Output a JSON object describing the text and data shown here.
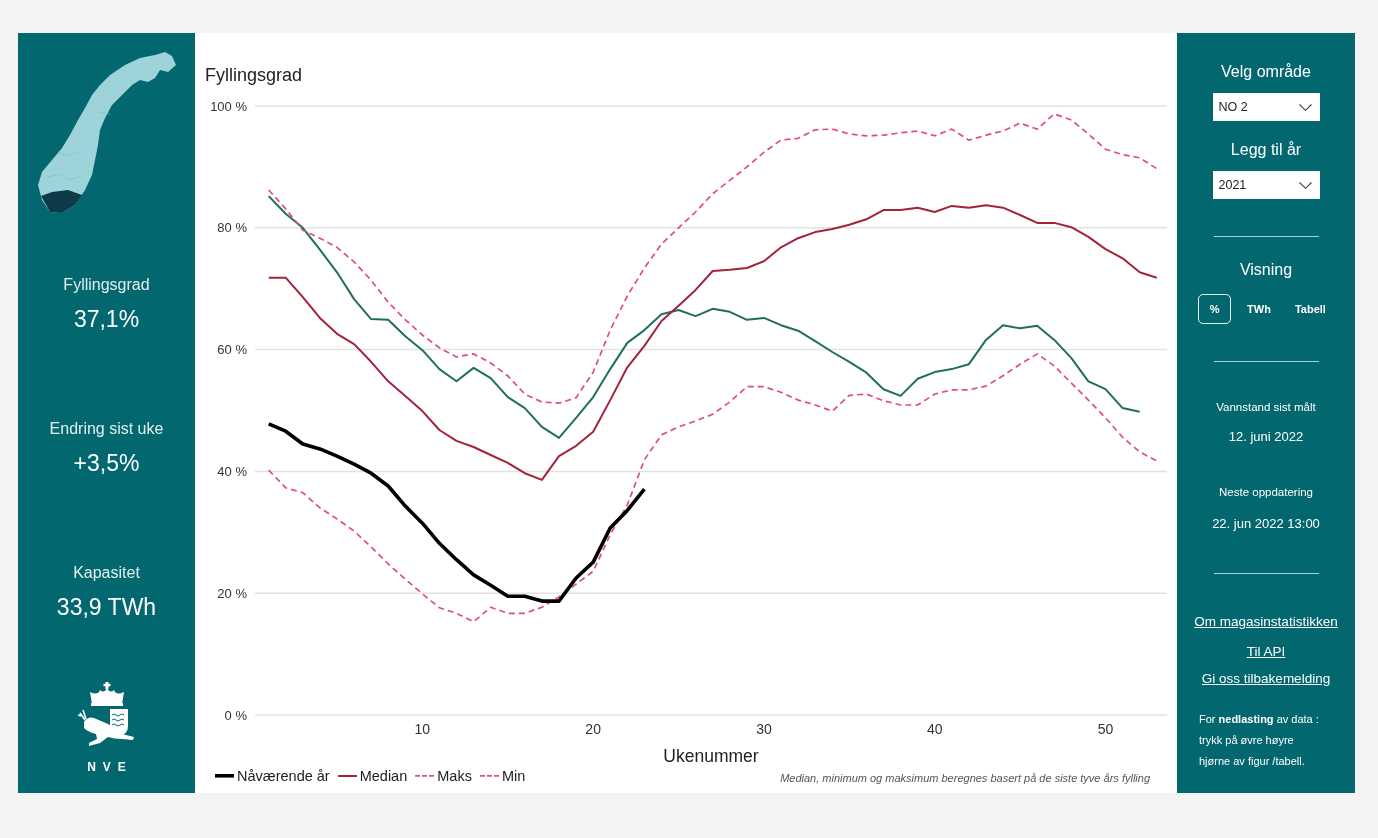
{
  "left_panel": {
    "stats": [
      {
        "label": "Fyllingsgrad",
        "value": "37,1%"
      },
      {
        "label": "Endring sist uke",
        "value": "+3,5%"
      },
      {
        "label": "Kapasitet",
        "value": "33,9 TWh"
      }
    ],
    "logo_text": "NVE"
  },
  "chart": {
    "chart_data": {
      "type": "line",
      "title": "Fyllingsgrad",
      "xlabel": "Ukenummer",
      "x": [
        1,
        2,
        3,
        4,
        5,
        6,
        7,
        8,
        9,
        10,
        11,
        12,
        13,
        14,
        15,
        16,
        17,
        18,
        19,
        20,
        21,
        22,
        23,
        24,
        25,
        26,
        27,
        28,
        29,
        30,
        31,
        32,
        33,
        34,
        35,
        36,
        37,
        38,
        39,
        40,
        41,
        42,
        43,
        44,
        45,
        46,
        47,
        48,
        49,
        50,
        51,
        52,
        53
      ],
      "xlim": [
        0.2,
        53.6
      ],
      "ylim": [
        0,
        100
      ],
      "xticks": [
        10,
        20,
        30,
        40,
        50
      ],
      "yticks": [
        {
          "value": 0,
          "label": "0 %"
        },
        {
          "value": 20,
          "label": "20 %"
        },
        {
          "value": 40,
          "label": "40 %"
        },
        {
          "value": 60,
          "label": "60 %"
        },
        {
          "value": 80,
          "label": "80 %"
        },
        {
          "value": 100,
          "label": "100 %"
        }
      ],
      "grid": true,
      "legend": true,
      "series": [
        {
          "name": "Nåværende år",
          "color": "#000000",
          "line_style": "solid",
          "values": [
            47.8,
            46.6,
            44.5,
            43.7,
            42.5,
            41.2,
            39.7,
            37.6,
            34.3,
            31.5,
            28.2,
            25.5,
            23.0,
            21.3,
            19.5,
            19.5,
            18.7,
            18.7,
            22.5,
            25.1,
            30.7,
            33.6,
            37.1,
            null,
            null,
            null,
            null,
            null,
            null,
            null,
            null,
            null,
            null,
            null,
            null,
            null,
            null,
            null,
            null,
            null,
            null,
            null,
            null,
            null,
            null,
            null,
            null,
            null,
            null,
            null,
            null,
            null,
            null
          ]
        },
        {
          "name": "Median",
          "color": "#a4233a",
          "line_style": "solid",
          "values": [
            71.8,
            71.8,
            68.6,
            65.2,
            62.6,
            60.9,
            58.0,
            54.8,
            52.4,
            49.9,
            46.8,
            45.0,
            44.0,
            42.7,
            41.4,
            39.7,
            38.6,
            42.5,
            44.2,
            46.5,
            51.7,
            57.1,
            60.6,
            64.7,
            67.2,
            69.8,
            72.9,
            73.1,
            73.4,
            74.5,
            76.8,
            78.3,
            79.3,
            79.8,
            80.5,
            81.4,
            82.9,
            82.9,
            83.3,
            82.6,
            83.6,
            83.3,
            83.7,
            83.3,
            82.1,
            80.8,
            80.8,
            80.1,
            78.5,
            76.5,
            75.0,
            72.7,
            71.8
          ]
        },
        {
          "name": "Maks",
          "color": "#e0506b",
          "line_style": "dashed",
          "values": [
            86.2,
            83.1,
            79.6,
            78.3,
            76.8,
            74.4,
            71.4,
            67.8,
            64.9,
            62.4,
            60.3,
            58.8,
            59.3,
            57.8,
            55.7,
            52.7,
            51.4,
            51.2,
            52.1,
            56.3,
            63.2,
            68.8,
            73.4,
            77.3,
            80.0,
            82.6,
            85.6,
            87.8,
            90.0,
            92.4,
            94.4,
            94.7,
            96.1,
            96.2,
            95.4,
            95.1,
            95.2,
            95.6,
            95.9,
            95.1,
            96.2,
            94.4,
            95.2,
            95.9,
            97.2,
            96.2,
            98.7,
            97.7,
            95.4,
            92.9,
            92.0,
            91.5,
            89.7
          ]
        },
        {
          "name": "Min",
          "color": "#e0506b",
          "line_style": "dashed",
          "values": [
            40.2,
            37.3,
            36.5,
            34.0,
            32.2,
            30.2,
            27.6,
            24.8,
            22.3,
            19.9,
            17.6,
            16.7,
            15.3,
            17.7,
            16.7,
            16.7,
            17.7,
            19.4,
            21.5,
            23.6,
            29.6,
            34.5,
            41.9,
            46.0,
            47.3,
            48.3,
            49.4,
            51.4,
            53.9,
            53.9,
            53.0,
            51.7,
            50.9,
            49.9,
            52.5,
            52.7,
            51.6,
            50.9,
            50.9,
            52.7,
            53.4,
            53.4,
            54.0,
            55.7,
            57.6,
            59.3,
            57.3,
            54.5,
            51.7,
            48.8,
            45.6,
            43.2,
            41.7
          ]
        },
        {
          "color": "#1f6e5e",
          "line_style": "solid",
          "values": [
            85.2,
            82.3,
            80.0,
            76.4,
            72.7,
            68.3,
            65.0,
            64.9,
            62.2,
            59.9,
            56.8,
            54.8,
            57.0,
            55.3,
            52.2,
            50.4,
            47.3,
            45.5,
            48.8,
            52.2,
            56.8,
            61.1,
            63.2,
            65.8,
            66.5,
            65.5,
            66.7,
            66.2,
            64.9,
            65.2,
            64.0,
            63.1,
            61.4,
            59.6,
            58.0,
            56.2,
            53.5,
            52.4,
            55.2,
            56.3,
            56.8,
            57.6,
            61.6,
            64.0,
            63.5,
            63.9,
            61.6,
            58.6,
            54.8,
            53.5,
            50.4,
            49.8,
            null
          ]
        }
      ]
    },
    "footnote": "Median, minimum og maksimum beregnes basert på de siste tyve års fylling"
  },
  "right_panel": {
    "area_select": {
      "label": "Velg område",
      "value": "NO 2"
    },
    "year_select": {
      "label": "Legg til år",
      "value": "2021"
    },
    "view": {
      "label": "Visning",
      "options": [
        {
          "label": "%",
          "selected": true
        },
        {
          "label": "TWh",
          "selected": false
        },
        {
          "label": "Tabell",
          "selected": false
        }
      ]
    },
    "info": [
      {
        "label": "Vannstand sist målt",
        "value": "12. juni 2022"
      },
      {
        "label": "Neste oppdatering",
        "value": "22. jun 2022 13:00"
      }
    ],
    "links": [
      "Om magasinstatistikken",
      "Til API",
      "Gi oss tilbakemelding"
    ],
    "download_note": "For **nedlasting** av data :\ntrykk på øvre høyre\nhjørne av figur /tabell."
  }
}
